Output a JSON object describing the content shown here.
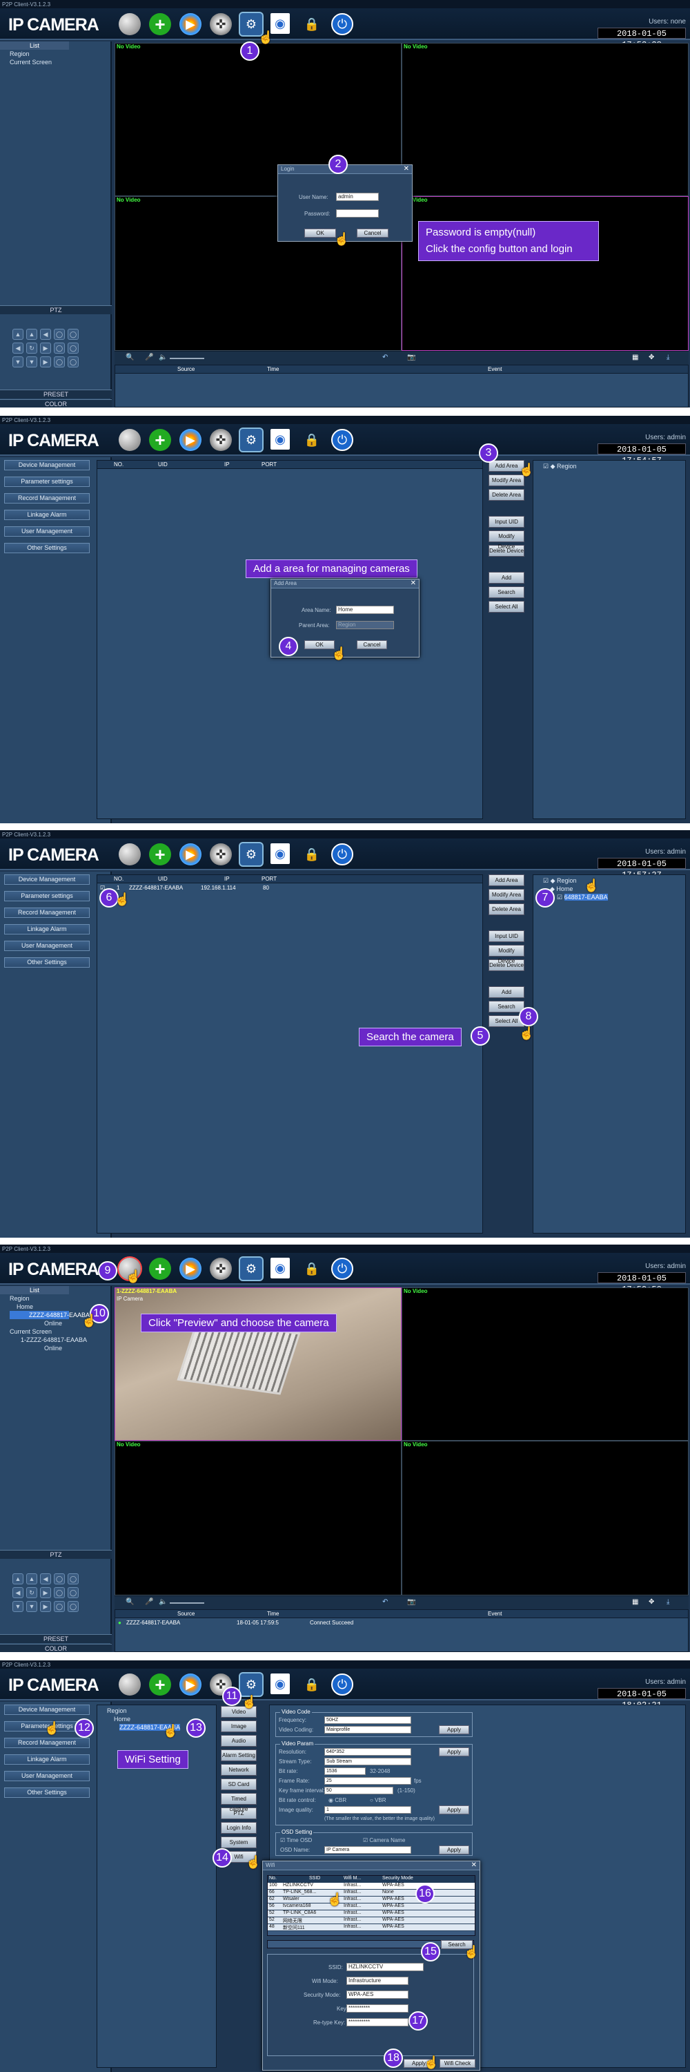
{
  "app": {
    "window_title": "P2P Client-V3.1.2.3",
    "logo": "IP CAMERA"
  },
  "panels": [
    {
      "users": "Users: none",
      "clock": "2018-01-05 17:53:38"
    },
    {
      "users": "Users: admin",
      "clock": "2018-01-05 17:54:57"
    },
    {
      "users": "Users: admin",
      "clock": "2018-01-05 17:57:27"
    },
    {
      "users": "Users: admin",
      "clock": "2018-01-05 17:59:50"
    },
    {
      "users": "Users: admin",
      "clock": "2018-01-05 18:02:21"
    }
  ],
  "sidebar_menu": [
    "Device Management",
    "Parameter settings",
    "Record Management",
    "Linkage Alarm",
    "User Management",
    "Other Settings"
  ],
  "preview": {
    "list_header": "List",
    "tree1": [
      "Region",
      "Current Screen"
    ],
    "tree4": [
      "Region",
      "Home",
      "ZZZZ-648817-EAABA",
      "Online",
      "Current Screen",
      "1-ZZZZ-648817-EAABA",
      "Online"
    ],
    "ptz_label": "PTZ",
    "preset_label": "PRESET",
    "color_label": "COLOR",
    "no_video": "No Video",
    "cam_caption": "1-ZZZZ-648817-EAABA",
    "cam_sub": "IP Camera",
    "log_headers": [
      "Source",
      "Time",
      "Event"
    ],
    "log_row": [
      "ZZZZ-648817-EAABA",
      "18-01-05 17:59:5",
      "Connect Succeed"
    ]
  },
  "login": {
    "title": "Login",
    "user_label": "User Name:",
    "user_value": "admin",
    "pwd_label": "Password:",
    "ok": "OK",
    "cancel": "Cancel"
  },
  "callouts": {
    "c1a": "Password is empty(null)",
    "c1b": "Click the config button and login",
    "c2": "Add a area for managing cameras",
    "c3": "Search the camera",
    "c4": "Click \"Preview\" and choose the camera",
    "c5": "WiFi Setting"
  },
  "device_table": {
    "headers": [
      "NO.",
      "UID",
      "IP",
      "PORT"
    ],
    "row": [
      "1",
      "ZZZZ-648817-EAABA",
      "192.168.1.114",
      "80"
    ]
  },
  "device_buttons": [
    "Add Area",
    "Modify Area",
    "Delete Area",
    "Input UID",
    "Modify Device",
    "Delete Device",
    "Add",
    "Search",
    "Select All"
  ],
  "region_tree": [
    "Region",
    "Home",
    "648817-EAABA"
  ],
  "add_area": {
    "title": "Add Area",
    "name_label": "Area Name:",
    "name_value": "Home",
    "parent_label": "Parent Area:",
    "parent_value": "Region",
    "ok": "OK",
    "cancel": "Cancel"
  },
  "settings": {
    "tree": [
      "Region",
      "Home",
      "ZZZZ-648817-EAABA"
    ],
    "tabs": [
      "Video",
      "Image",
      "Audio",
      "Alarm Setting",
      "Network",
      "SD Card",
      "Timed capture",
      "PTZ",
      "Login Info",
      "System",
      "Wifi"
    ],
    "video_code": {
      "title": "Video Code",
      "freq_label": "Frequency:",
      "freq_value": "50HZ",
      "coding_label": "Video Coding:",
      "coding_value": "Mainprofile",
      "apply": "Apply"
    },
    "video_param": {
      "title": "Video Param",
      "res_label": "Resolution:",
      "res_value": "640*352",
      "stream_label": "Stream Type:",
      "stream_value": "Sub Stream",
      "bitrate_label": "Bit rate:",
      "bitrate_value": "1536",
      "bitrate_range": "32-2048",
      "fps_label": "Frame Rate:",
      "fps_value": "25",
      "fps_unit": "fps",
      "kf_label": "Key frame interval:",
      "kf_value": "50",
      "kf_range": "(1-150)",
      "brc_label": "Bit rate control:",
      "cbr": "CBR",
      "vbr": "VBR",
      "iq_label": "Image quality:",
      "iq_value": "1",
      "iq_note": "(The smaller the value, the better the image quality)",
      "apply": "Apply"
    },
    "osd": {
      "title": "OSD Setting",
      "time_osd": "Time OSD",
      "cam_name": "Camera Name",
      "osd_name_label": "OSD Name:",
      "osd_name_value": "IP Camera",
      "apply": "Apply"
    }
  },
  "wifi": {
    "title": "Wifi",
    "headers": [
      "No.",
      "SSID",
      "Wifi M...",
      "Security Mode"
    ],
    "rows": [
      [
        "100",
        "HZLINKCCTV",
        "Infrast...",
        "WPA-AES"
      ],
      [
        "66",
        "TP-LINK_568...",
        "Infrast...",
        "None"
      ],
      [
        "62",
        "Wtsaler",
        "Infrast...",
        "WPA-AES"
      ],
      [
        "56",
        "tvcamera168",
        "Infrast...",
        "WPA-AES"
      ],
      [
        "52",
        "TP-LINK_C8A6",
        "Infrast...",
        "WPA-AES"
      ],
      [
        "52",
        "网络无限",
        "Infrast...",
        "WPA-AES"
      ],
      [
        "48",
        "新空间111",
        "Infrast...",
        "WPA-AES"
      ]
    ],
    "search": "Search",
    "ssid_label": "SSID:",
    "ssid_value": "HZLINKCCTV",
    "mode_label": "Wifi Mode:",
    "mode_value": "Infrastructure",
    "sec_label": "Security Mode:",
    "sec_value": "WPA-AES",
    "key_label": "Key:",
    "key_value": "**********",
    "rekey_label": "Re-type Key:",
    "rekey_value": "**********",
    "apply": "Apply",
    "check": "Wifi Check"
  },
  "badges": [
    "1",
    "2",
    "3",
    "4",
    "5",
    "6",
    "7",
    "8",
    "9",
    "10",
    "11",
    "12",
    "13",
    "14",
    "15",
    "16",
    "17",
    "18"
  ]
}
